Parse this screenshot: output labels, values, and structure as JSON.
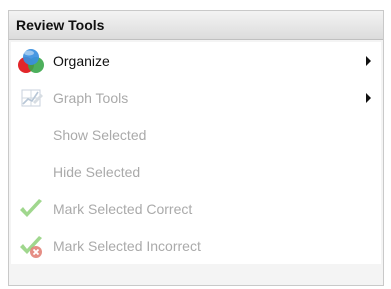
{
  "menu": {
    "title": "Review Tools",
    "items": [
      {
        "label": "Organize",
        "icon": "organize-icon",
        "enabled": true,
        "submenu": true
      },
      {
        "label": "Graph Tools",
        "icon": "graph-tools-icon",
        "enabled": false,
        "submenu": true
      },
      {
        "label": "Show Selected",
        "icon": "",
        "enabled": false,
        "submenu": false
      },
      {
        "label": "Hide Selected",
        "icon": "",
        "enabled": false,
        "submenu": false
      },
      {
        "label": "Mark Selected Correct",
        "icon": "checkmark-icon",
        "enabled": false,
        "submenu": false
      },
      {
        "label": "Mark Selected Incorrect",
        "icon": "checkmark-x-icon",
        "enabled": false,
        "submenu": false
      }
    ]
  },
  "colors": {
    "enabled_text": "#111111",
    "disabled_text": "#aaaaaa",
    "organize_red": "#e2262a",
    "organize_green": "#3aa64a",
    "organize_blue": "#3a8fe0",
    "check_green": "#8fd07a",
    "x_red": "#e07a70"
  }
}
